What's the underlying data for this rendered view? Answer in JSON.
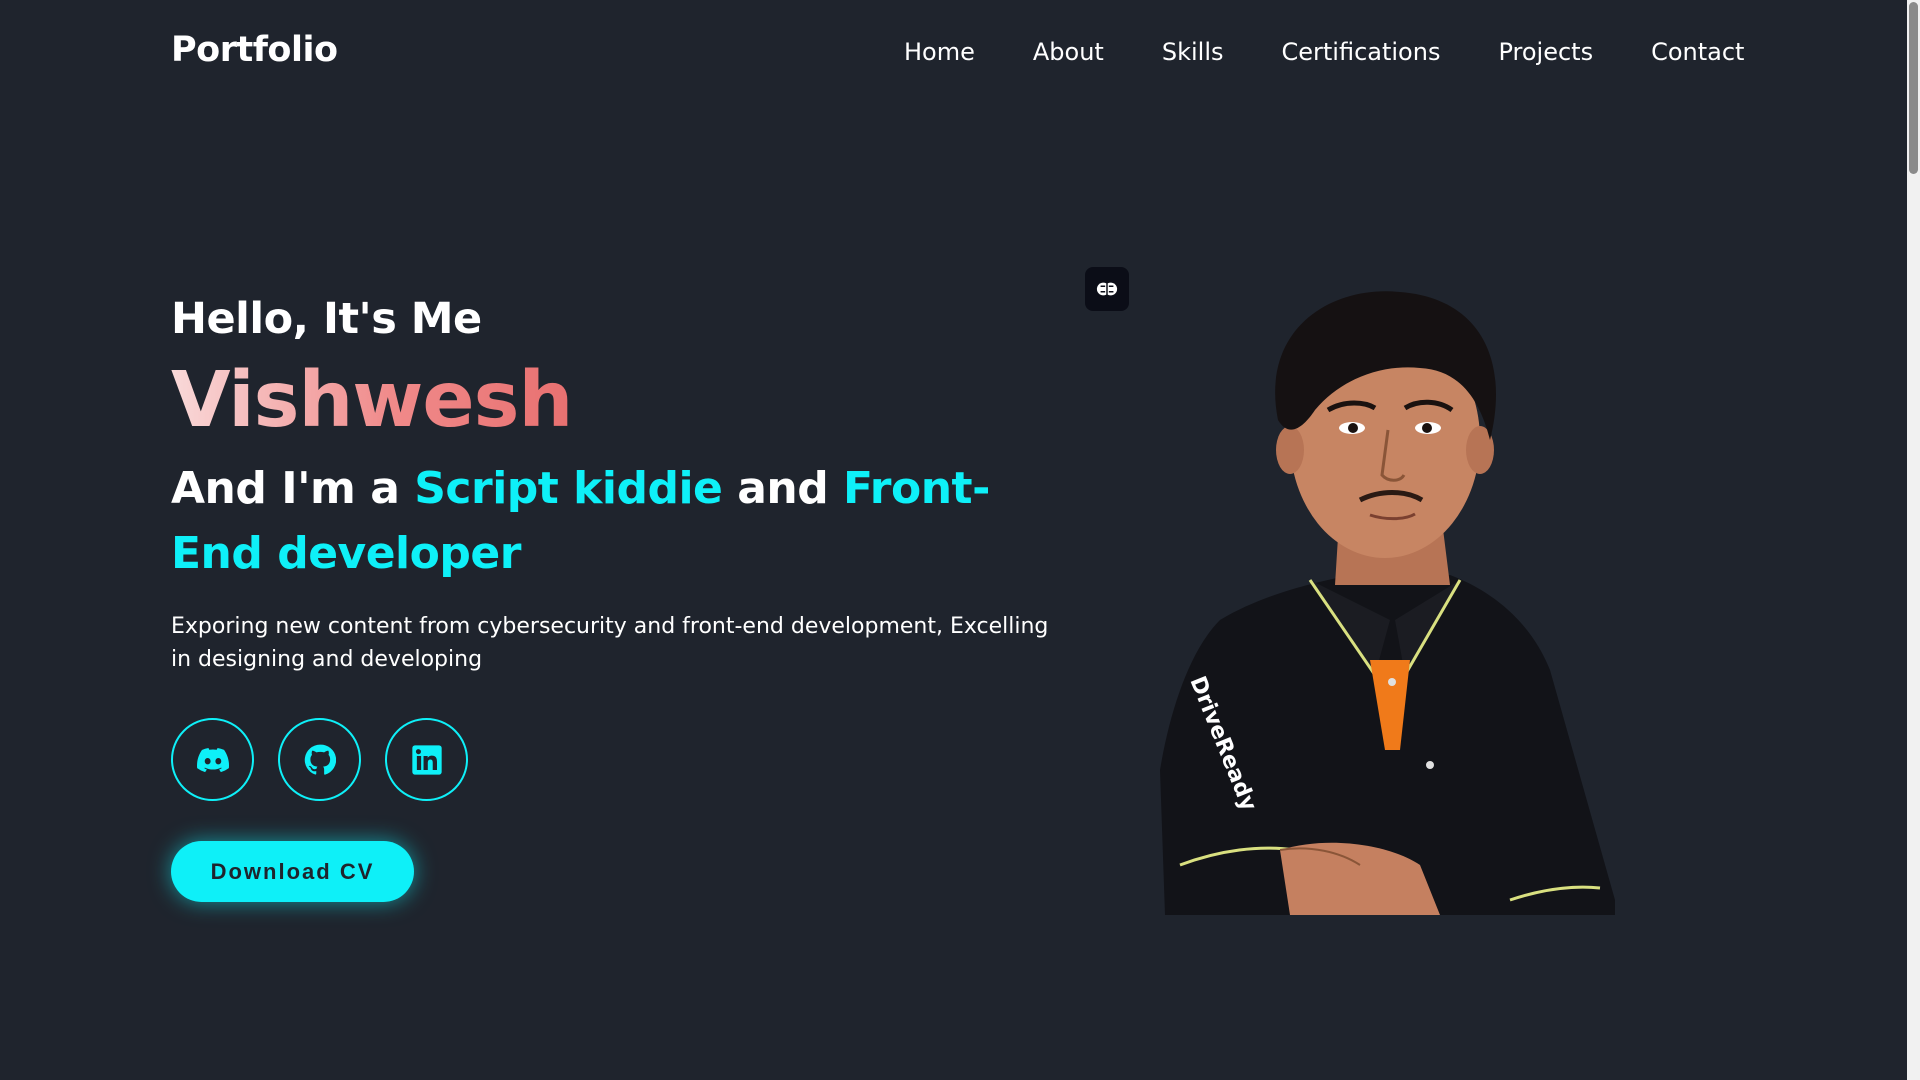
{
  "header": {
    "logo": "Portfolio",
    "nav": [
      "Home",
      "About",
      "Skills",
      "Certifications",
      "Projects",
      "Contact"
    ]
  },
  "hero": {
    "greeting": "Hello, It's Me",
    "name": "Vishwesh",
    "tagline_prefix": "And I'm a ",
    "role_1": "Script kiddie",
    "tagline_mid": " and ",
    "role_2": "Front-End developer",
    "description": "Exporing new content from cybersecurity and front-end development, Excelling in designing and developing",
    "cv_button": "Download CV"
  },
  "socials": [
    {
      "icon": "discord-icon"
    },
    {
      "icon": "github-icon"
    },
    {
      "icon": "linkedin-icon"
    }
  ],
  "portrait_shirt_text": "DriveReady",
  "colors": {
    "background": "#1f242d",
    "accent": "#0ef0f8",
    "name_gradient_start": "#f9d9d9",
    "name_gradient_end": "#e87070"
  }
}
